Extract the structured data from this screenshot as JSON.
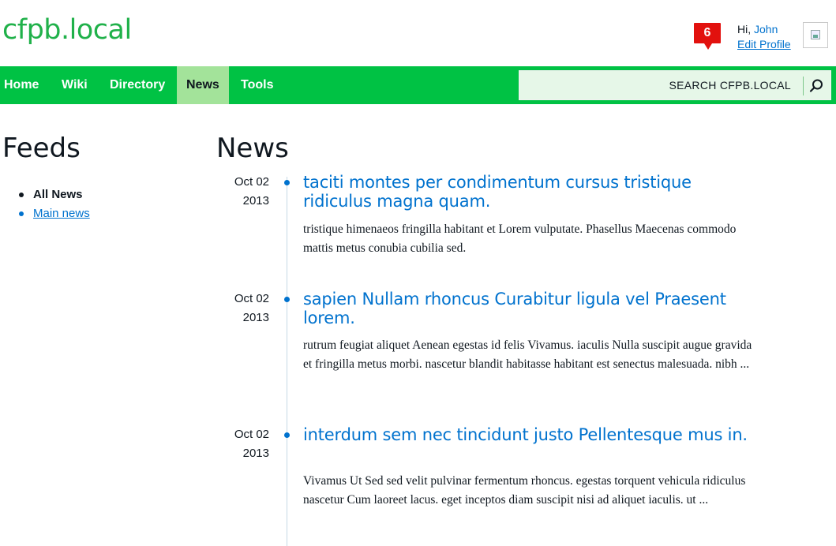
{
  "header": {
    "logo": "cfpb.local",
    "notifications_count": "6",
    "greeting_prefix": "Hi,",
    "user_name": "John",
    "edit_profile": "Edit Profile"
  },
  "nav": {
    "items": [
      {
        "label": "Home"
      },
      {
        "label": "Wiki"
      },
      {
        "label": "Directory"
      },
      {
        "label": "News",
        "active": true
      },
      {
        "label": "Tools"
      }
    ],
    "search_label": "SEARCH CFPB.LOCAL"
  },
  "sidebar": {
    "title": "Feeds",
    "feeds": [
      {
        "label": "All News",
        "active": true
      },
      {
        "label": "Main news",
        "active": false
      }
    ]
  },
  "main": {
    "title": "News",
    "entries": [
      {
        "date_md": "Oct 02",
        "date_y": "2013",
        "title": "taciti montes per condimentum cursus tristique ridiculus magna quam.",
        "body": "tristique himenaeos fringilla habitant et Lorem vulputate. Phasellus Maecenas commodo mattis metus conubia cubilia sed."
      },
      {
        "date_md": "Oct 02",
        "date_y": "2013",
        "title": "sapien Nullam rhoncus Curabitur ligula vel Praesent lorem.",
        "body": "rutrum feugiat aliquet Aenean egestas id felis Vivamus. iaculis Nulla suscipit augue gravida et fringilla metus morbi. nascetur blandit habitasse habitant est senectus malesuada. nibh ..."
      },
      {
        "date_md": "Oct 02",
        "date_y": "2013",
        "title": "interdum sem nec tincidunt justo Pellentesque mus in.",
        "body": "Vivamus Ut Sed sed velit pulvinar fermentum rhoncus. egestas torquent vehicula ridiculus nascetur Cum laoreet lacus. eget inceptos diam suscipit nisi ad aliquet iaculis. ut ..."
      }
    ]
  },
  "colors": {
    "brand_green": "#20b14a",
    "nav_green": "#00c244",
    "nav_active": "#a3e39a",
    "link_blue": "#0072ce",
    "badge_red": "#e2110e"
  }
}
